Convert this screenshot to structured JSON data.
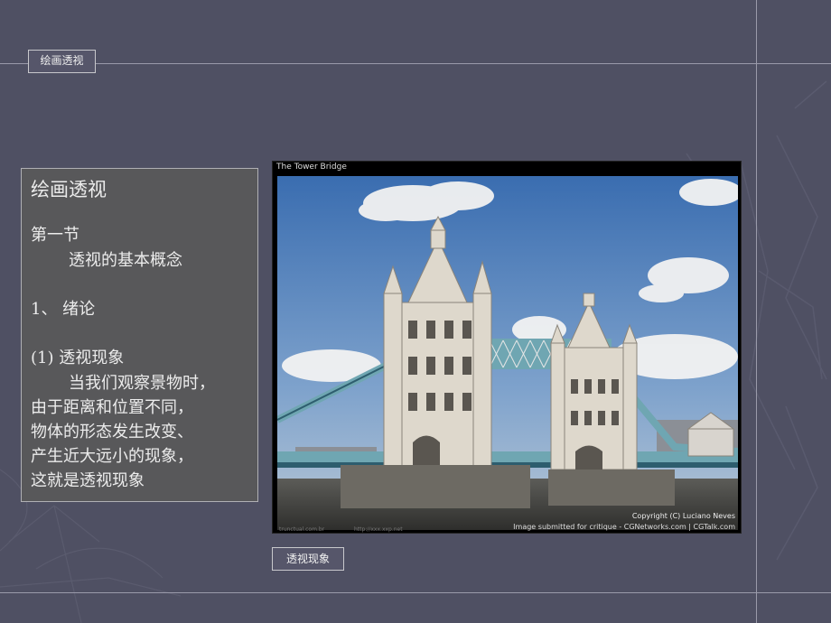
{
  "header": {
    "tag": "绘画透视"
  },
  "text_box": {
    "title": "绘画透视",
    "section": "第一节",
    "subtitle": "透视的基本概念",
    "chapter": "1、 绪论",
    "topic": "(1) 透视现象",
    "para": [
      "当我们观察景物时，",
      "由于距离和位置不同，",
      "物体的形态发生改变、",
      "产生近大远小的现象，",
      "这就是透视现象"
    ]
  },
  "photo": {
    "title": "The Tower Bridge",
    "copyright": "Copyright (C) Luciano Neves",
    "credit": "Image submitted for critique - CGNetworks.com | CGTalk.com",
    "wm_left": "trunctual.com.br",
    "wm_mid": "http://xxx.xxp.net"
  },
  "caption": "透视现象",
  "colors": {
    "background": "#4f5063",
    "box": "#58585a",
    "water": "#4a4a48",
    "bridge": "#ded8cc",
    "walkway": "#6fa6b2"
  }
}
